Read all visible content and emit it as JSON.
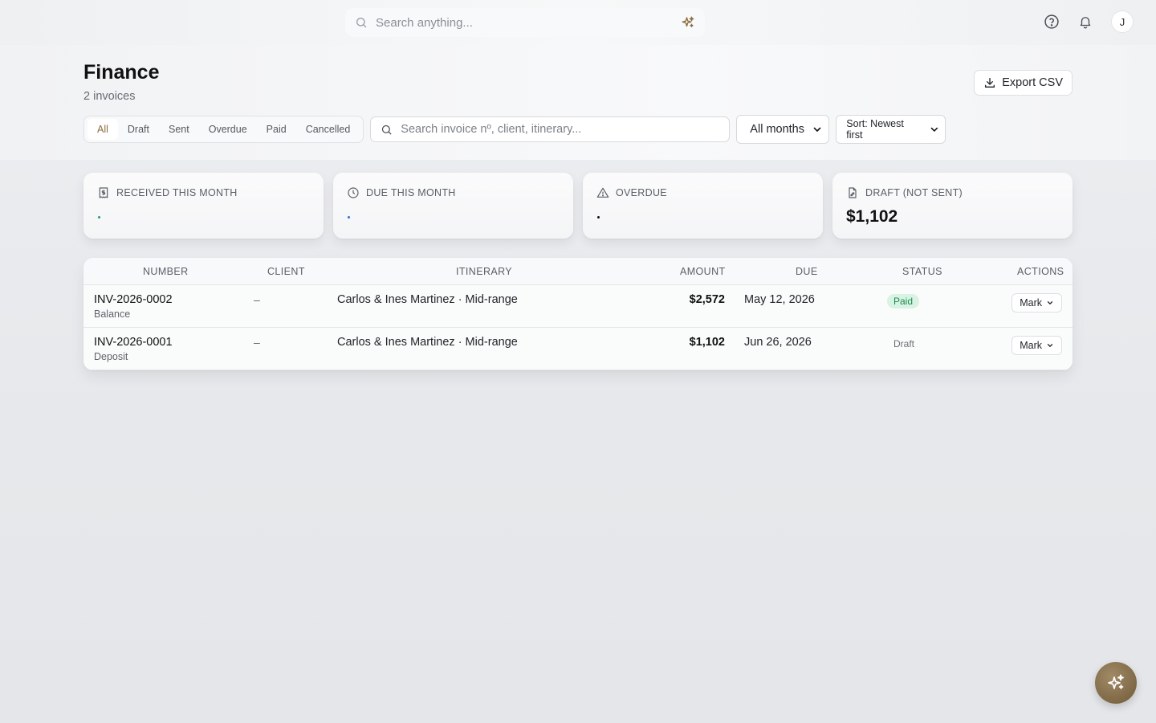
{
  "topbar": {
    "search_placeholder": "Search anything...",
    "avatar_initial": "J"
  },
  "header": {
    "title": "Finance",
    "subtitle": "2 invoices",
    "export_label": "Export CSV"
  },
  "filters": {
    "status_tabs": [
      "All",
      "Draft",
      "Sent",
      "Overdue",
      "Paid",
      "Cancelled"
    ],
    "active_tab": "All",
    "search_placeholder": "Search invoice nº, client, itinerary...",
    "month_select": "All months",
    "sort_select": "Sort: Newest first"
  },
  "stats": [
    {
      "label": "RECEIVED THIS MONTH",
      "value": "",
      "dot_color": "#1e9d6a"
    },
    {
      "label": "DUE THIS MONTH",
      "value": "",
      "dot_color": "#2d6fd6"
    },
    {
      "label": "OVERDUE",
      "value": "",
      "dot_color": "#111111"
    },
    {
      "label": "DRAFT (NOT SENT)",
      "value": "$1,102"
    }
  ],
  "table": {
    "columns": {
      "number": "NUMBER",
      "client": "CLIENT",
      "itinerary": "ITINERARY",
      "amount": "AMOUNT",
      "due": "DUE",
      "status": "STATUS",
      "actions": "ACTIONS"
    },
    "rows": [
      {
        "number": "INV-2026-0002",
        "type": "Balance",
        "client": "–",
        "itinerary": "Carlos & Ines Martinez · Mid-range",
        "amount": "$2,572",
        "due": "May 12, 2026",
        "status": "Paid",
        "action": "Mark"
      },
      {
        "number": "INV-2026-0001",
        "type": "Deposit",
        "client": "–",
        "itinerary": "Carlos & Ines Martinez · Mid-range",
        "amount": "$1,102",
        "due": "Jun 26, 2026",
        "status": "Draft",
        "action": "Mark"
      }
    ]
  },
  "colors": {
    "accent": "#8b6d3f",
    "paid_badge_bg": "#d8f3e4",
    "paid_badge_text": "#1e8a4c",
    "fab": "#7f6845"
  },
  "icons": {
    "search": "search-icon",
    "ai": "sparkles-icon",
    "help": "help-circle-icon",
    "notifications": "bell-icon",
    "export": "download-icon"
  }
}
